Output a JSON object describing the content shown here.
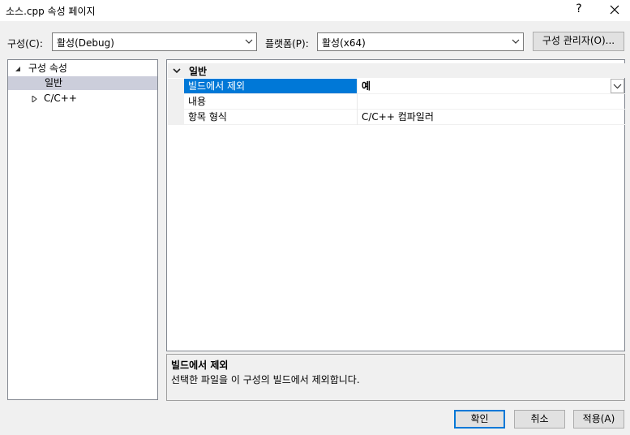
{
  "window": {
    "title": "소스.cpp 속성 페이지",
    "help_label": "?",
    "close_icon": "close-icon"
  },
  "toolbar": {
    "configuration_label": "구성(C):",
    "configuration_value": "활성(Debug)",
    "platform_label": "플랫폼(P):",
    "platform_value": "활성(x64)",
    "config_manager_label": "구성 관리자(O)..."
  },
  "tree": {
    "root_label": "구성 속성",
    "items": [
      {
        "label": "일반",
        "selected": true
      },
      {
        "label": "C/C++",
        "selected": false
      }
    ]
  },
  "grid": {
    "category": "일반",
    "rows": [
      {
        "name": "빌드에서 제외",
        "value": "예",
        "selected": true
      },
      {
        "name": "내용",
        "value": ""
      },
      {
        "name": "항목 형식",
        "value": "C/C++ 컴파일러"
      }
    ]
  },
  "description": {
    "title": "빌드에서 제외",
    "text": "선택한 파일을 이 구성의 빌드에서 제외합니다."
  },
  "buttons": {
    "ok": "확인",
    "cancel": "취소",
    "apply": "적용(A)"
  },
  "colors": {
    "selection": "#0078d7",
    "tree_selection": "#cccedb",
    "background": "#f0f0f0"
  }
}
